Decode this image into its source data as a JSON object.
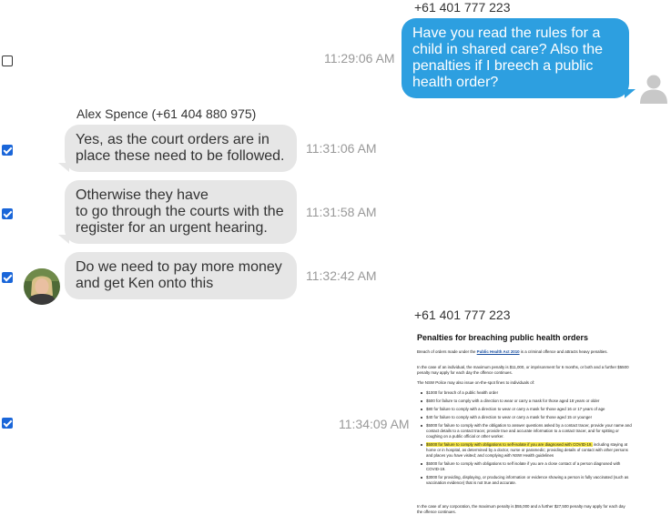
{
  "messages": [
    {
      "sender": "+61 401 777 223",
      "time": "11:29:06 AM",
      "lines": [
        "Have you read the rules for a",
        "child in shared care? Also the",
        "penalties if I breech a public",
        "health order?"
      ]
    },
    {
      "sender": "Alex Spence (+61 404 880 975)",
      "time": "11:31:06 AM",
      "lines": [
        "Yes, as the court orders are in",
        "place these need to be followed."
      ]
    },
    {
      "time": "11:31:58 AM",
      "lines": [
        "Otherwise they have",
        "to go through the courts with the",
        "register for an urgent hearing."
      ]
    },
    {
      "time": "11:32:42 AM",
      "lines": [
        "Do we need to pay more money",
        "and get Ken onto this"
      ]
    },
    {
      "sender": "+61 401 777 223",
      "time": "11:34:09 AM"
    }
  ],
  "attachment": {
    "title": "Penalties for breaching public health orders",
    "intro_pre": "Breach of orders made under the ",
    "intro_link": "Public Health Act 2010",
    "intro_post": " is a criminal offence and attracts heavy penalties.",
    "para_individual": "In the case of an individual, the maximum penalty is $11,000, or imprisonment for 6 months, or both and a further $5500 penalty may apply for each day the offence continues.",
    "para_police": "The NSW Police may also issue on-the-spot fines to individuals of:",
    "fines": [
      "$1000 for breach of a public health order",
      "$500 for failure to comply with a direction to wear or carry a mask for those aged 18 years or older",
      "$80 for failure to comply with a direction to wear or carry a mask for those aged 16 or 17 years of age",
      "$40 for failure to comply with a direction to wear or carry a mask for those aged 15 or younger",
      "$5000 for failure to comply with the obligation to answer questions asked by a contact tracer, provide your name and contact details to a contact tracer, provide true and accurate information to a contact tracer, and for spitting or coughing on a public official or other worker."
    ],
    "fine_highlight": "$5000 for failure to comply with obligations to self-isolate if you are diagnosed with COVID-19,",
    "fine_highlight_rest": " including staying at home or in hospital, as determined by a doctor, nurse or paramedic; providing details of contact with other persons and places you have visited; and complying with NSW Health guidelines",
    "fines_after": [
      "$5000 for failure to comply with obligations to self isolate if you are a close contact of a person diagnosed with COVID-19.",
      "$3000 for providing, displaying, or producing information or evidence showing a person is fully vaccinated (such as vaccination evidence) that is not true and accurate."
    ],
    "para_corporation": "In the case of any corporation, the maximum penalty is $55,000 and a further $27,500 penalty may apply for each day the offence continues."
  },
  "selection": [
    false,
    true,
    true,
    true,
    true
  ]
}
